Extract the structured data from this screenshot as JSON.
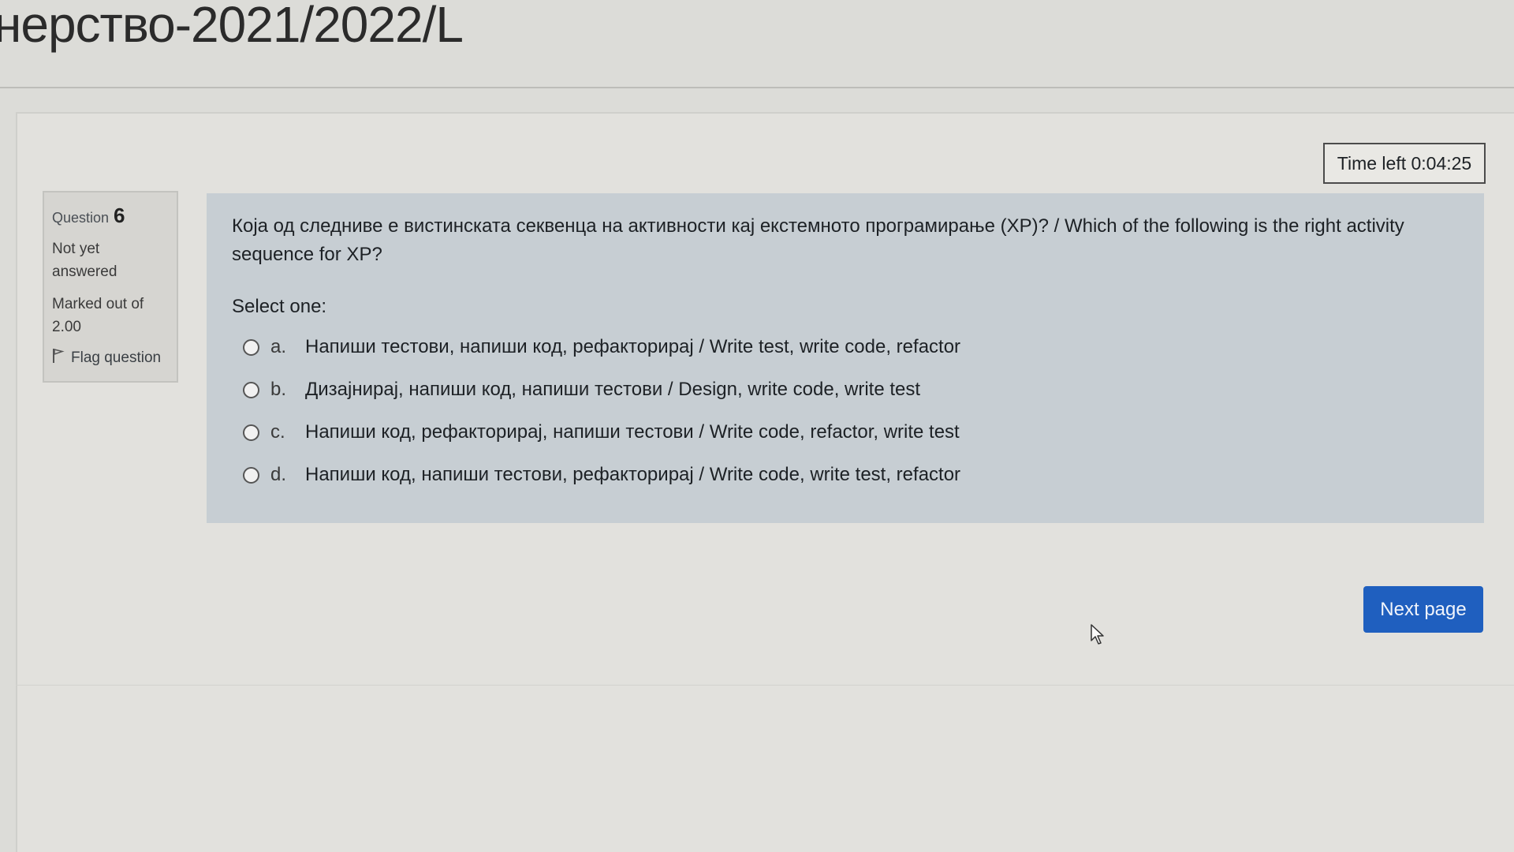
{
  "page": {
    "title": "нерство-2021/2022/L"
  },
  "timer": {
    "text": "Time left 0:04:25"
  },
  "question_info": {
    "label": "Question",
    "number": "6",
    "state": "Not yet answered",
    "grade": "Marked out of 2.00",
    "flag_label": "Flag question"
  },
  "question": {
    "text": "Која од следниве е вистинската секвенца на активности кај екстемното програмирање (XP)? / Which of the following is the right activity sequence for XP?",
    "prompt": "Select one:",
    "answers": [
      {
        "letter": "a.",
        "text": "Напиши тестови, напиши код, рефакторирај / Write test, write code, refactor",
        "selected": false
      },
      {
        "letter": "b.",
        "text": "Дизајнирај, напиши код, напиши тестови / Design, write code, write test",
        "selected": false
      },
      {
        "letter": "c.",
        "text": "Напиши код, рефакторирај, напиши тестови / Write code, refactor, write test",
        "selected": false
      },
      {
        "letter": "d.",
        "text": "Напиши код, напиши тестови, рефакторирај / Write code, write test, refactor",
        "selected": false
      }
    ]
  },
  "navigation": {
    "next_label": "Next page"
  },
  "icons": {
    "flag": "flag-icon",
    "cursor": "mouse-pointer-icon"
  },
  "colors": {
    "primary_button": "#1f5fbf",
    "question_background": "#c7ced3"
  }
}
